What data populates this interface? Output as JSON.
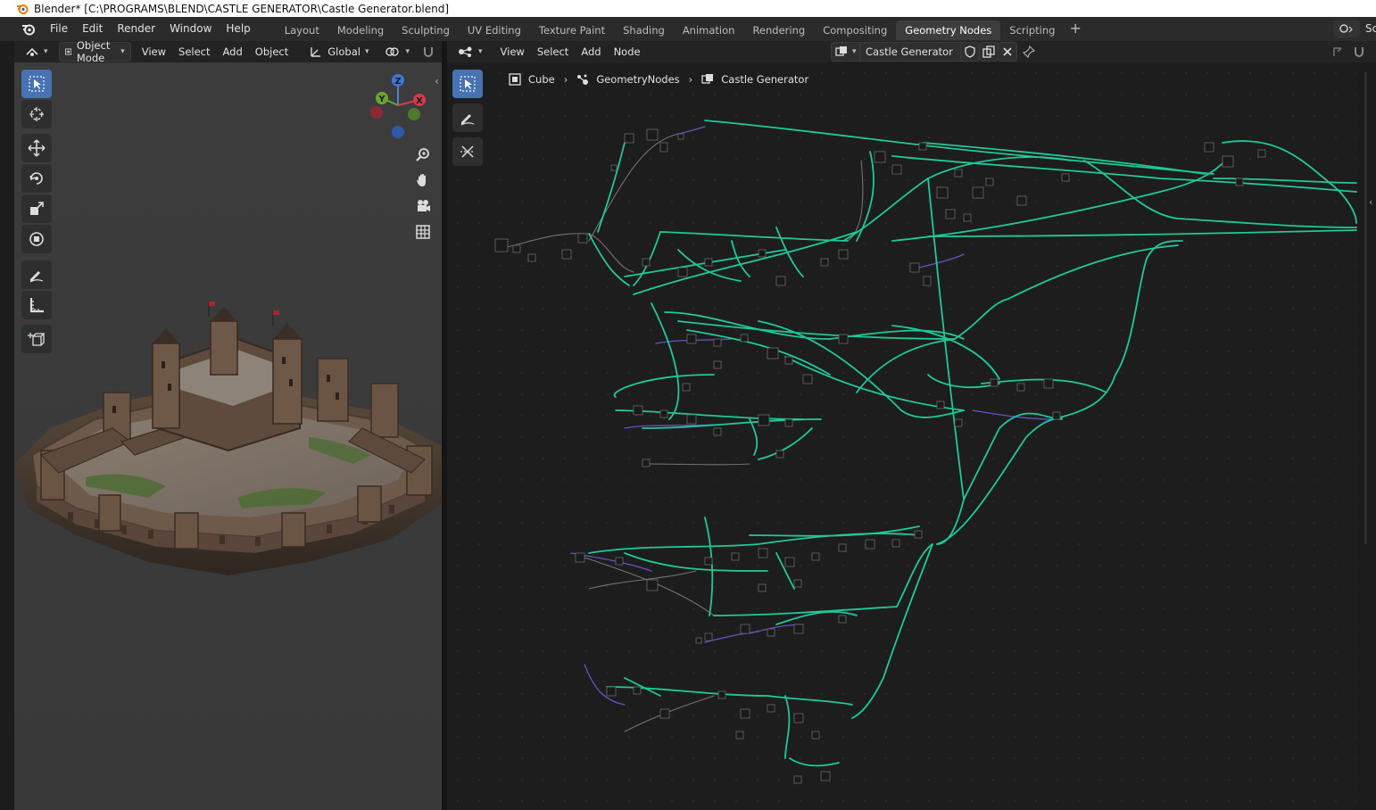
{
  "window": {
    "title": "Blender* [C:\\PROGRAMS\\BLEND\\CASTLE GENERATOR\\Castle Generator.blend]"
  },
  "topbar": {
    "menus": [
      "File",
      "Edit",
      "Render",
      "Window",
      "Help"
    ],
    "workspaces": [
      "Layout",
      "Modeling",
      "Sculpting",
      "UV Editing",
      "Texture Paint",
      "Shading",
      "Animation",
      "Rendering",
      "Compositing",
      "Geometry Nodes",
      "Scripting"
    ],
    "active_workspace": "Geometry Nodes",
    "scene_label": "Sc"
  },
  "viewport_header": {
    "mode": "Object Mode",
    "menus": [
      "View",
      "Select",
      "Add",
      "Object"
    ],
    "orientation": "Global"
  },
  "node_header": {
    "menus": [
      "View",
      "Select",
      "Add",
      "Node"
    ],
    "node_group": "Castle Generator"
  },
  "breadcrumb": {
    "object": "Cube",
    "modifier": "GeometryNodes",
    "node_group": "Castle Generator"
  },
  "gizmo": {
    "z": "Z",
    "y": "Y",
    "x": "X"
  },
  "colors": {
    "accent": "#4772b3",
    "link_green": "#1fc99a",
    "link_purple": "#6b5bd6",
    "link_grey": "#8a8a8a"
  }
}
